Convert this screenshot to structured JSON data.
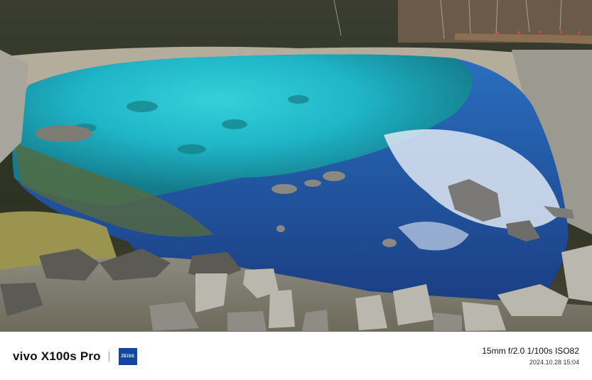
{
  "footer": {
    "camera_model": "vivo X100s Pro",
    "lens_brand": "ZEISS",
    "exposure": "15mm  f/2.0  1/100s  ISO82",
    "datetime": "2024.10.28 15:04"
  },
  "colors": {
    "zeiss_blue": "#1446a0",
    "lake_turquoise": "#1fb6c8",
    "lake_deep_blue": "#1f4f9e",
    "forest": "#2c3323"
  }
}
